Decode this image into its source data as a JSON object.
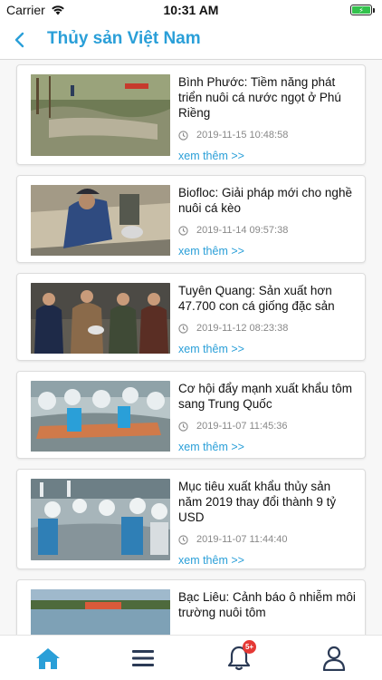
{
  "status_bar": {
    "carrier": "Carrier",
    "time": "10:31 AM"
  },
  "header": {
    "title": "Thủy sản Việt Nam",
    "back_icon": "chevron-left-icon",
    "accent_color": "#2a9fd8"
  },
  "articles": [
    {
      "title": "Bình Phước: Tiềm năng phát triển nuôi cá nước ngọt ở Phú Riềng",
      "date": "2019-11-15 10:48:58",
      "more": "xem thêm >>"
    },
    {
      "title": "Biofloc: Giải pháp mới cho nghề nuôi cá kèo",
      "date": "2019-11-14 09:57:38",
      "more": "xem thêm >>"
    },
    {
      "title": "Tuyên Quang: Sản xuất hơn 47.700 con cá giống đặc sản",
      "date": "2019-11-12 08:23:38",
      "more": "xem thêm >>"
    },
    {
      "title": "Cơ hội đẩy mạnh xuất khẩu tôm sang Trung Quốc",
      "date": "2019-11-07 11:45:36",
      "more": "xem thêm >>"
    },
    {
      "title": "Mục tiêu xuất khẩu thủy sản năm 2019 thay đổi thành 9 tỷ USD",
      "date": "2019-11-07 11:44:40",
      "more": "xem thêm >>"
    },
    {
      "title": "Bạc Liêu: Cảnh báo ô nhiễm môi trường nuôi tôm",
      "date": "",
      "more": ""
    }
  ],
  "tab_bar": {
    "home_icon": "home-icon",
    "menu_icon": "menu-icon",
    "notification_icon": "bell-icon",
    "notification_badge": "5+",
    "profile_icon": "user-icon"
  }
}
